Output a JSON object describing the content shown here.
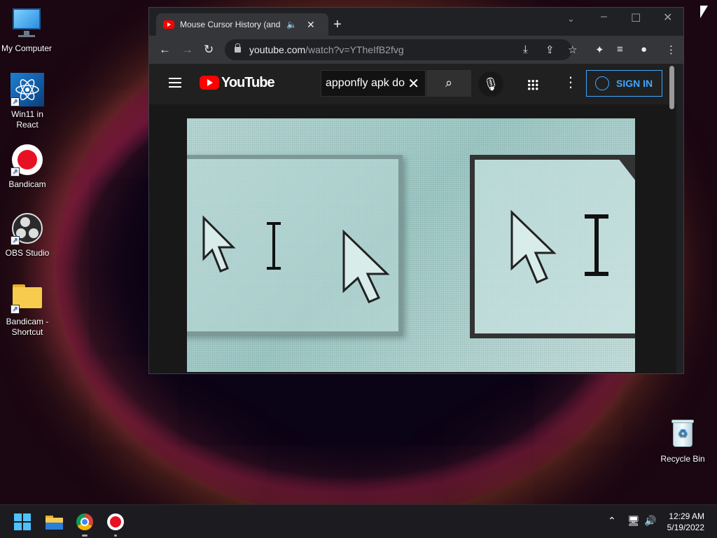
{
  "desktop": {
    "icons": [
      {
        "label": "My Computer"
      },
      {
        "label": "Win11 in React"
      },
      {
        "label": "Bandicam"
      },
      {
        "label": "OBS Studio"
      },
      {
        "label": "Bandicam - Shortcut"
      },
      {
        "label": "Recycle Bin"
      }
    ]
  },
  "browser": {
    "tab_title": "Mouse Cursor History (and w",
    "new_tab_symbol": "+",
    "url_host": "youtube.com",
    "url_path": "/watch?v=YTheIfB2fvg"
  },
  "youtube": {
    "logo_text": "YouTube",
    "search_value": "apponfly apk do",
    "sign_in_label": "SIGN IN"
  },
  "taskbar": {
    "time": "12:29 AM",
    "date": "5/19/2022"
  },
  "colors": {
    "accent": "#3ea6ff",
    "youtube_red": "#ff0000",
    "bandicam_red": "#e81123"
  }
}
